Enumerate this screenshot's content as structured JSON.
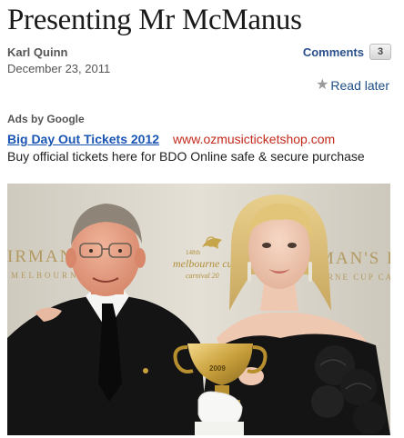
{
  "article": {
    "title": "Presenting Mr McManus",
    "author": "Karl Quinn",
    "date": "December 23, 2011",
    "comments_label": "Comments",
    "comments_count": "3",
    "read_later_label": "Read later"
  },
  "ads": {
    "label": "Ads by Google",
    "items": [
      {
        "title": "Big Day Out Tickets 2012",
        "url": "www.ozmusicticketshop.com",
        "text": "Buy official tickets here for BDO Online safe & secure purchase"
      }
    ]
  },
  "photo": {
    "backdrop_left_1": "IRMAN'S",
    "backdrop_left_2": "MELBOURNE",
    "backdrop_center_1": "148th",
    "backdrop_center_2": "melbourne cup",
    "backdrop_center_3": "carnival 20",
    "backdrop_right_1": "MAN'S DI",
    "backdrop_right_2": "RNE CUP CA",
    "cup_year": "2009"
  },
  "colors": {
    "link_blue": "#1a55b4",
    "ad_url_red": "#c4291c",
    "comments_blue": "#2a4f8c"
  }
}
